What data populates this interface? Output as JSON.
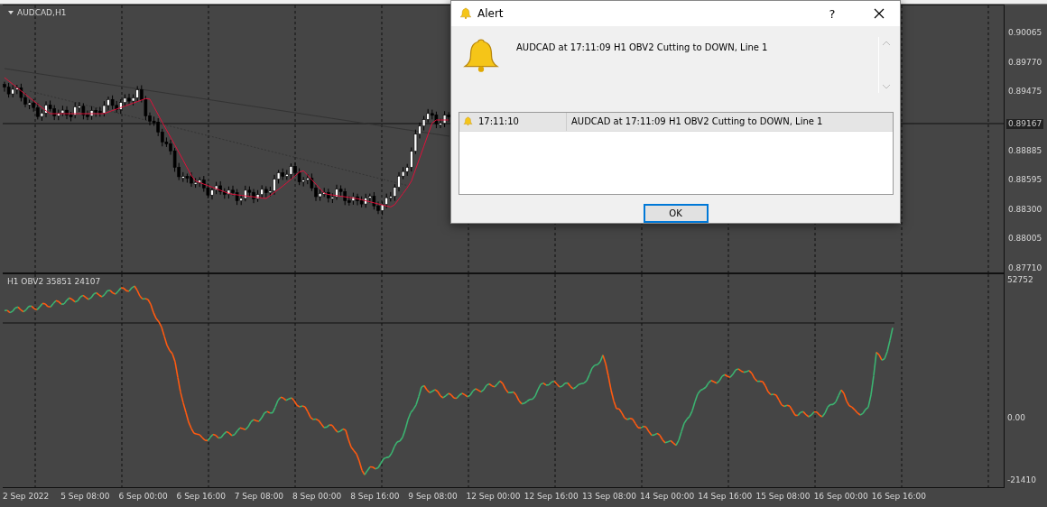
{
  "chart": {
    "symbol": "AUDCAD,H1",
    "price_labels": [
      {
        "text": "0.90065",
        "kind": "tick"
      },
      {
        "text": "0.89770",
        "kind": "tick"
      },
      {
        "text": "0.89475",
        "kind": "tick"
      },
      {
        "text": "0.89167",
        "kind": "current"
      },
      {
        "text": "0.88885",
        "kind": "tick"
      },
      {
        "text": "0.88595",
        "kind": "tick"
      },
      {
        "text": "0.88300",
        "kind": "tick"
      },
      {
        "text": "0.88005",
        "kind": "tick"
      },
      {
        "text": "0.87710",
        "kind": "tick"
      }
    ]
  },
  "indicator": {
    "label": "H1 OBV2 35851 24107",
    "scale_labels": [
      "52752",
      "0.00",
      "-21410"
    ]
  },
  "time_axis": [
    "2 Sep 2022",
    "5 Sep 08:00",
    "6 Sep 00:00",
    "6 Sep 16:00",
    "7 Sep 08:00",
    "8 Sep 00:00",
    "8 Sep 16:00",
    "9 Sep 08:00",
    "12 Sep 00:00",
    "12 Sep 16:00",
    "13 Sep 08:00",
    "14 Sep 00:00",
    "14 Sep 16:00",
    "15 Sep 08:00",
    "16 Sep 00:00",
    "16 Sep 16:00"
  ],
  "alert": {
    "title": "Alert",
    "help_button": "?",
    "message": "AUDCAD at 17:11:09 H1 OBV2  Cutting to DOWN, Line 1",
    "list": [
      {
        "time": "17:11:10",
        "message": "AUDCAD at 17:11:09 H1 OBV2  Cutting to DOWN, Line 1",
        "selected": true
      }
    ],
    "ok_button": "OK"
  }
}
